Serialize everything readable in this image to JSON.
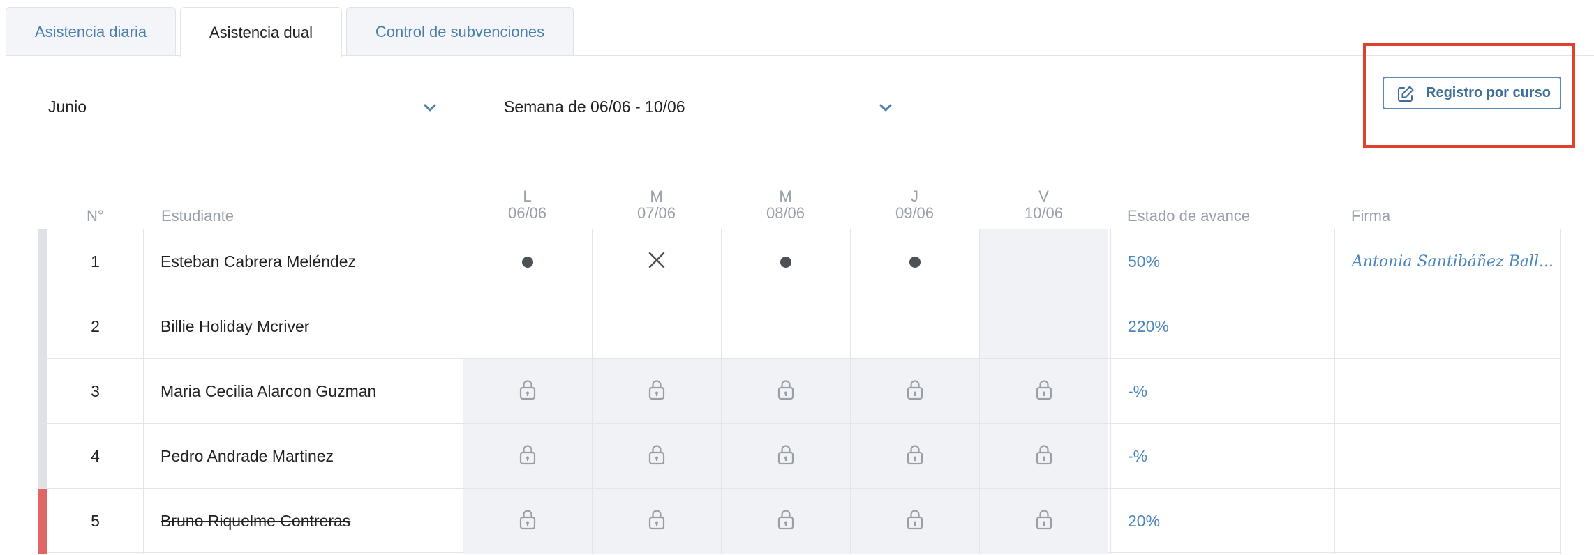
{
  "tabs": [
    "Asistencia diaria",
    "Asistencia dual",
    "Control de subvenciones"
  ],
  "filters": {
    "month": "Junio",
    "week": "Semana de 06/06 - 10/06"
  },
  "register_button": "Registro por curso",
  "table": {
    "headers": {
      "number": "N°",
      "student": "Estudiante",
      "progress": "Estado de avance",
      "signature": "Firma"
    },
    "days": [
      {
        "letter": "L",
        "date": "06/06"
      },
      {
        "letter": "M",
        "date": "07/06"
      },
      {
        "letter": "M",
        "date": "08/06"
      },
      {
        "letter": "J",
        "date": "09/06"
      },
      {
        "letter": "V",
        "date": "10/06"
      }
    ],
    "rows": [
      {
        "num": "1",
        "name": "Esteban Cabrera Meléndez",
        "progress": "50%",
        "signature": "Antonia Santibáñez Ball..."
      },
      {
        "num": "2",
        "name": "Billie Holiday Mcriver",
        "progress": "220%",
        "signature": ""
      },
      {
        "num": "3",
        "name": "Maria Cecilia Alarcon Guzman",
        "progress": "-%",
        "signature": ""
      },
      {
        "num": "4",
        "name": "Pedro Andrade Martinez",
        "progress": "-%",
        "signature": ""
      },
      {
        "num": "5",
        "name": "Bruno Riquelme Contreras",
        "progress": "20%",
        "signature": ""
      }
    ]
  },
  "icons": {
    "chevron": "chevron-down-icon",
    "edit": "edit-icon",
    "present": "dot-icon",
    "absent": "x-icon",
    "locked": "lock-icon"
  },
  "colors": {
    "accent": "#4a86bd",
    "highlight": "#e0412e",
    "withdrawn": "#e06666"
  }
}
